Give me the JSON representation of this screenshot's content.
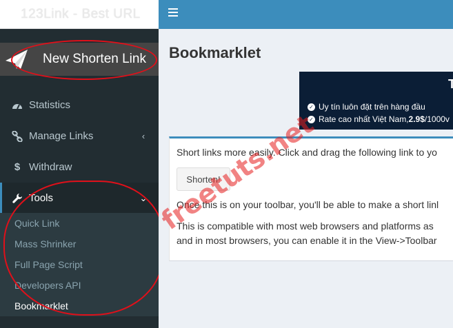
{
  "brand": {
    "logo_text": "123Link - Best URL"
  },
  "sidebar": {
    "new_link_label": "New Shorten Link",
    "items": [
      {
        "label": "Statistics",
        "icon": "dashboard-icon"
      },
      {
        "label": "Manage Links",
        "icon": "link-icon",
        "chevron": "‹"
      },
      {
        "label": "Withdraw",
        "icon": "dollar-icon"
      },
      {
        "label": "Tools",
        "icon": "wrench-icon",
        "chevron": "⌄"
      }
    ],
    "submenu": [
      "Quick Link",
      "Mass Shrinker",
      "Full Page Script",
      "Developers API",
      "Bookmarklet"
    ]
  },
  "page": {
    "title": "Bookmarklet",
    "banner": {
      "big_letter": "T",
      "line1": "Uy tín luôn đặt trên hàng đầu",
      "line2_prefix": "Rate cao nhất Việt Nam, ",
      "line2_bold": "2.9$",
      "line2_suffix": "/1000v"
    },
    "box": {
      "line1": "Short links more easily. Click and drag the following link to yo",
      "button_label": "Shorten!",
      "line2": "Once this is on your toolbar, you'll be able to make a short linl",
      "line3": "This is compatible with most web browsers and platforms as",
      "line4": "and in most browsers, you can enable it in the View->Toolbar"
    }
  },
  "watermark": "freetuts.net",
  "colors": {
    "topbar": "#3c8dbc",
    "sidebar": "#222d32",
    "annotation": "#e0101a"
  }
}
